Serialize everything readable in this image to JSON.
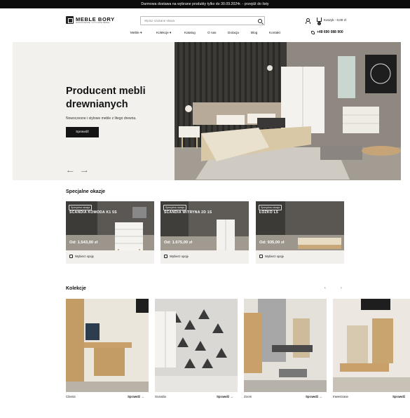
{
  "topbar": {
    "text": "Darmowa dostawa na wybrane produkty tylko do 30.09.2024r. - przejdź do listy"
  },
  "logo": {
    "name": "MEBLE BORY",
    "tagline": "NOWOCZESNE I STYLOWE MEBLE"
  },
  "search": {
    "placeholder": "Wpisz szukane słowa"
  },
  "cart": {
    "label": "Koszyk - 0,00 zł",
    "count": "0"
  },
  "nav": {
    "items": [
      "Meble",
      "Kolekcje",
      "Katalog",
      "O nas",
      "Dotacja",
      "Blog",
      "Kontakt"
    ]
  },
  "phone": "+48 690 088 900",
  "hero": {
    "title": "Producent mebli drewnianych",
    "subtitle": "Nowoczesne i stylowe meble z litego drewna.",
    "button": "Sprawdź",
    "prev": "⟵",
    "next": "⟶"
  },
  "specials": {
    "title": "Specjalne okazje",
    "items": [
      {
        "tag": "Specjalna okazja",
        "name": "SCANDIA KOMODA K1 5S",
        "price": "Od: 1.543,00 zł",
        "option": "Wybierz opcję"
      },
      {
        "tag": "Specjalna okazja",
        "name": "SCANDIA WITRYNA 2D 1S",
        "price": "Od: 1.675,00 zł",
        "option": "Wybierz opcję"
      },
      {
        "tag": "Specjalna okazja",
        "name": "ŁÓŻKO L5",
        "price": "Od: 935,00 zł",
        "option": "Wybierz opcję"
      }
    ]
  },
  "collections": {
    "title": "Kolekcje",
    "prev": "‹",
    "next": "›",
    "items": [
      {
        "name": "Classic",
        "more": "Sprawdź"
      },
      {
        "name": "Scandia",
        "more": "Sprawdź"
      },
      {
        "name": "Zoom",
        "more": "Sprawdź"
      },
      {
        "name": "Inwestcase",
        "more": "Sprawdź"
      }
    ]
  },
  "colors": {
    "dark": "#141414",
    "hero_bg": "#f2f1ee",
    "card_bg": "#f1f0ed"
  }
}
